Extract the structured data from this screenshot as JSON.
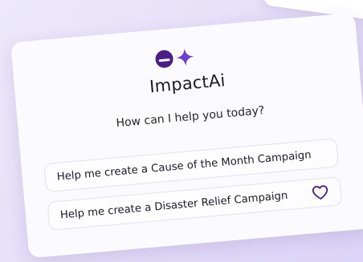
{
  "app": {
    "name": "ImpactAi",
    "prompt": "How can I help you today?"
  },
  "suggestions": [
    {
      "label": "Help me create a Cause of the Month Campaign"
    },
    {
      "label": "Help me create a Disaster Relief Campaign"
    }
  ],
  "icons": {
    "logo": [
      "logo-circle-icon",
      "sparkle-icon"
    ],
    "suggestion_action": "heart-icon"
  },
  "colors": {
    "brand_purple": "#4b1e85",
    "accent_violet": "#6a3fd0",
    "card_background": "#fbfafe",
    "page_background": "#e6e0f8"
  }
}
